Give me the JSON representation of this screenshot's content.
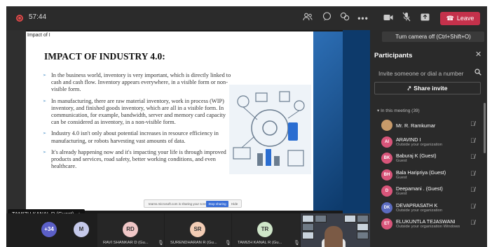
{
  "topbar": {
    "timer": "57:44",
    "leave_label": "Leave",
    "icons": [
      "recording-icon",
      "people-icon",
      "chat-icon",
      "reactions-icon",
      "more-icon",
      "camera-icon",
      "mic-off-icon",
      "share-tray-icon"
    ]
  },
  "tooltip": "Turn camera off (Ctrl+Shift+O)",
  "slide": {
    "corner_label": "Impact of I",
    "title": "IMPACT OF INDUSTRY 4.0:",
    "bullets": [
      "In the business world, inventory is very important, which is directly linked to cash and cash flow. Inventory appears everywhere, in a visible form or non-visible form.",
      "In manufacturing, there are raw material inventory, work in process (WIP) inventory, and finished goods inventory, which are all in a visible form. In communication, for example, bandwidth, server and memory card capacity can be considered as inventory, in a non-visible form.",
      "Industry 4.0 isn't only about potential increases in resource efficiency in manufacturing, or robots harvesting vast amounts of data.",
      "It's already happening now and it's impacting your life is through improved products and services, road safety, better working conditions, and even healthcare."
    ],
    "share_banner": "teams.microsoft.com is sharing your screen.",
    "stop_sharing": "Stop sharing",
    "hide": "Hide",
    "presenter_tag": "TAMIZH KANAL R (Guest)"
  },
  "panel": {
    "title": "Participants",
    "invite_placeholder": "Invite someone or dial a number",
    "share_invite": "Share invite",
    "in_meeting": "In this meeting (39)",
    "participants": [
      {
        "initials": "",
        "name": "Mr. R. Ramkumar",
        "sub": "",
        "color": "#c79a6a"
      },
      {
        "initials": "AI",
        "name": "ARAVIND I",
        "sub": "Outside your organization",
        "color": "#d8557a"
      },
      {
        "initials": "BK",
        "name": "Baburaj K (Guest)",
        "sub": "Guest",
        "color": "#d8557a"
      },
      {
        "initials": "BH",
        "name": "Bala Haripriya (Guest)",
        "sub": "Guest",
        "color": "#d8557a"
      },
      {
        "initials": "D",
        "name": "Deepamani . (Guest)",
        "sub": "Guest",
        "color": "#d8557a"
      },
      {
        "initials": "DK",
        "name": "DEVAPRASATH K",
        "sub": "Outside your organization",
        "color": "#5b6bc0"
      },
      {
        "initials": "ET",
        "name": "ELUKUNTLA TEJASWANI",
        "sub": "Outside your organization   Windows",
        "color": "#d8557a"
      }
    ]
  },
  "bottom": {
    "overflow_count": "+34",
    "tiles": [
      {
        "initials": "M",
        "name": "",
        "color": "#c5c9ea"
      },
      {
        "initials": "RD",
        "name": "RAVI SHANKAR D (Gu...",
        "color": "#f0c7c7"
      },
      {
        "initials": "SR",
        "name": "SURENDHARAN R (Gu...",
        "color": "#f3cdb5"
      },
      {
        "initials": "TR",
        "name": "TAMIZH KANAL R (Gu...",
        "color": "#cfe6c9"
      }
    ]
  }
}
